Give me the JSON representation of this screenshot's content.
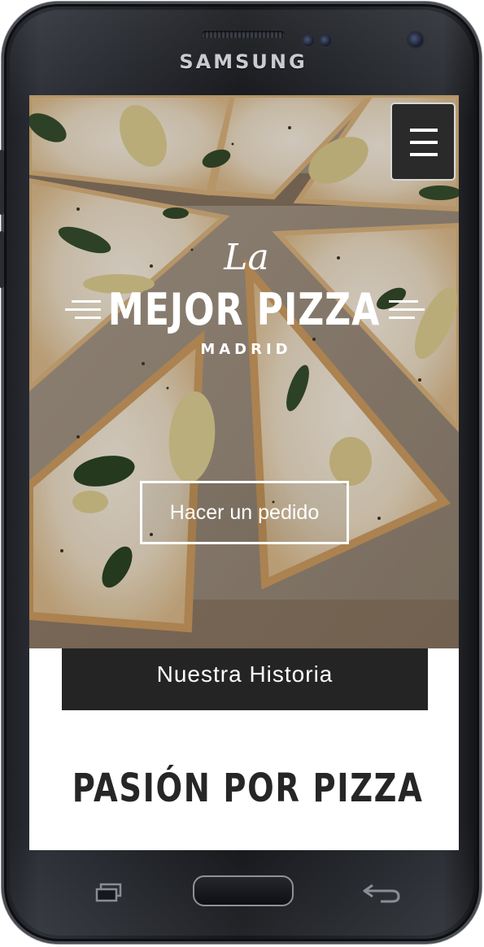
{
  "device": {
    "brand": "SAMSUNG"
  },
  "header": {
    "menu_icon": "hamburger-icon"
  },
  "hero": {
    "logo_script": "La",
    "logo_main": "MEJOR PIZZA",
    "logo_city": "MADRID",
    "cta_label": "Hacer un pedido"
  },
  "story": {
    "tab_label": "Nuestra Historia",
    "heading": "PASIÓN POR PIZZA"
  },
  "softkeys": {
    "recent_icon": "recent-apps-icon",
    "home_icon": "home-button",
    "back_icon": "back-arrow-icon"
  },
  "colors": {
    "dark_panel": "#242424",
    "heading_text": "#262626",
    "hero_text": "#ffffff"
  }
}
